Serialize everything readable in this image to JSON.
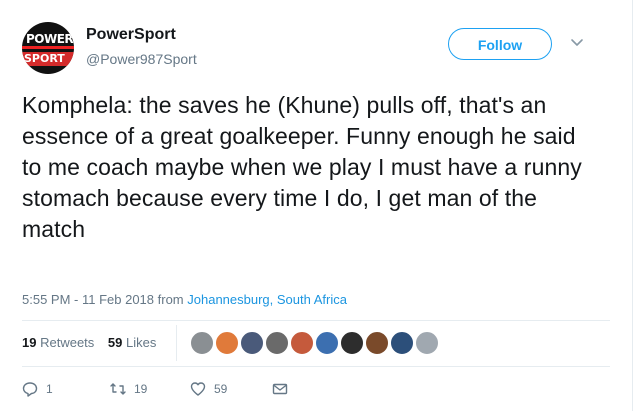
{
  "profile": {
    "name": "PowerSport",
    "handle": "@Power987Sport",
    "avatar_text_top": "POWER",
    "avatar_text_bottom": "SPORT"
  },
  "follow_label": "Follow",
  "tweet": {
    "text": "Komphela: the saves he (Khune) pulls off, that's an essence of a great goalkeeper. Funny enough he said to me coach maybe when we play I must have a runny stomach because every time I do, I get man of the match",
    "timestamp": "5:55 PM - 11 Feb 2018",
    "from_label": "from",
    "location": "Johannesburg, South Africa"
  },
  "stats": {
    "retweets_count": "19",
    "retweets_label": "Retweets",
    "likes_count": "59",
    "likes_label": "Likes"
  },
  "likers": [
    "#8a8f93",
    "#e07a3a",
    "#4a5a7a",
    "#6a6a6a",
    "#c55a3c",
    "#3c6fb0",
    "#2d2d2d",
    "#7a4a2a",
    "#2c4f7a",
    "#a0a8b0"
  ],
  "actions": {
    "reply_count": "1",
    "retweet_count": "19",
    "like_count": "59"
  },
  "colors": {
    "accent": "#1da1f2",
    "link": "#1b95e0",
    "muted": "#657786"
  }
}
